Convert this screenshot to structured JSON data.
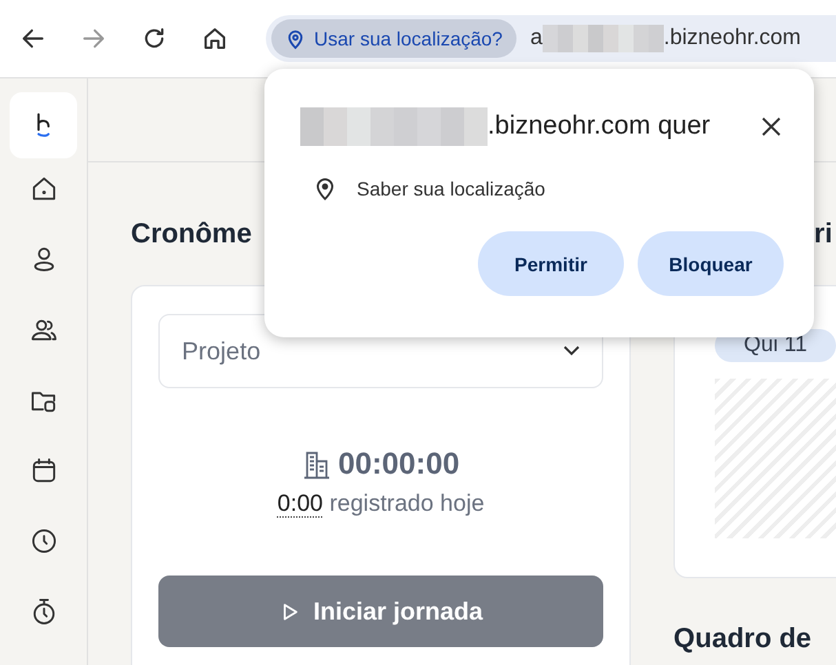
{
  "browser": {
    "nav_buttons": [
      {
        "kind": "back",
        "disabled": false
      },
      {
        "kind": "forward",
        "disabled": true
      },
      {
        "kind": "reload",
        "disabled": false
      },
      {
        "kind": "home",
        "disabled": false
      }
    ],
    "location_chip": "Usar sua localização?",
    "url_start": "a",
    "url_end": ".bizneohr.com"
  },
  "sidebar": {
    "items": [
      {
        "kind": "home"
      },
      {
        "kind": "person"
      },
      {
        "kind": "people"
      },
      {
        "kind": "folder"
      },
      {
        "kind": "calendar"
      },
      {
        "kind": "clock"
      },
      {
        "kind": "stopwatch"
      }
    ]
  },
  "left": {
    "heading": "Cronôme",
    "project_placeholder": "Projeto",
    "timer": "00:00:00",
    "logged": "0:00",
    "logged_label": "registrado hoje",
    "start_button": "Iniciar jornada"
  },
  "right": {
    "heading": "ri",
    "day_chip": "Qui 11",
    "board_heading": "Quadro de"
  },
  "popup": {
    "title": ".bizneohr.com quer",
    "permission": "Saber sua localização",
    "buttons": [
      "Permitir",
      "Bloquear"
    ]
  }
}
